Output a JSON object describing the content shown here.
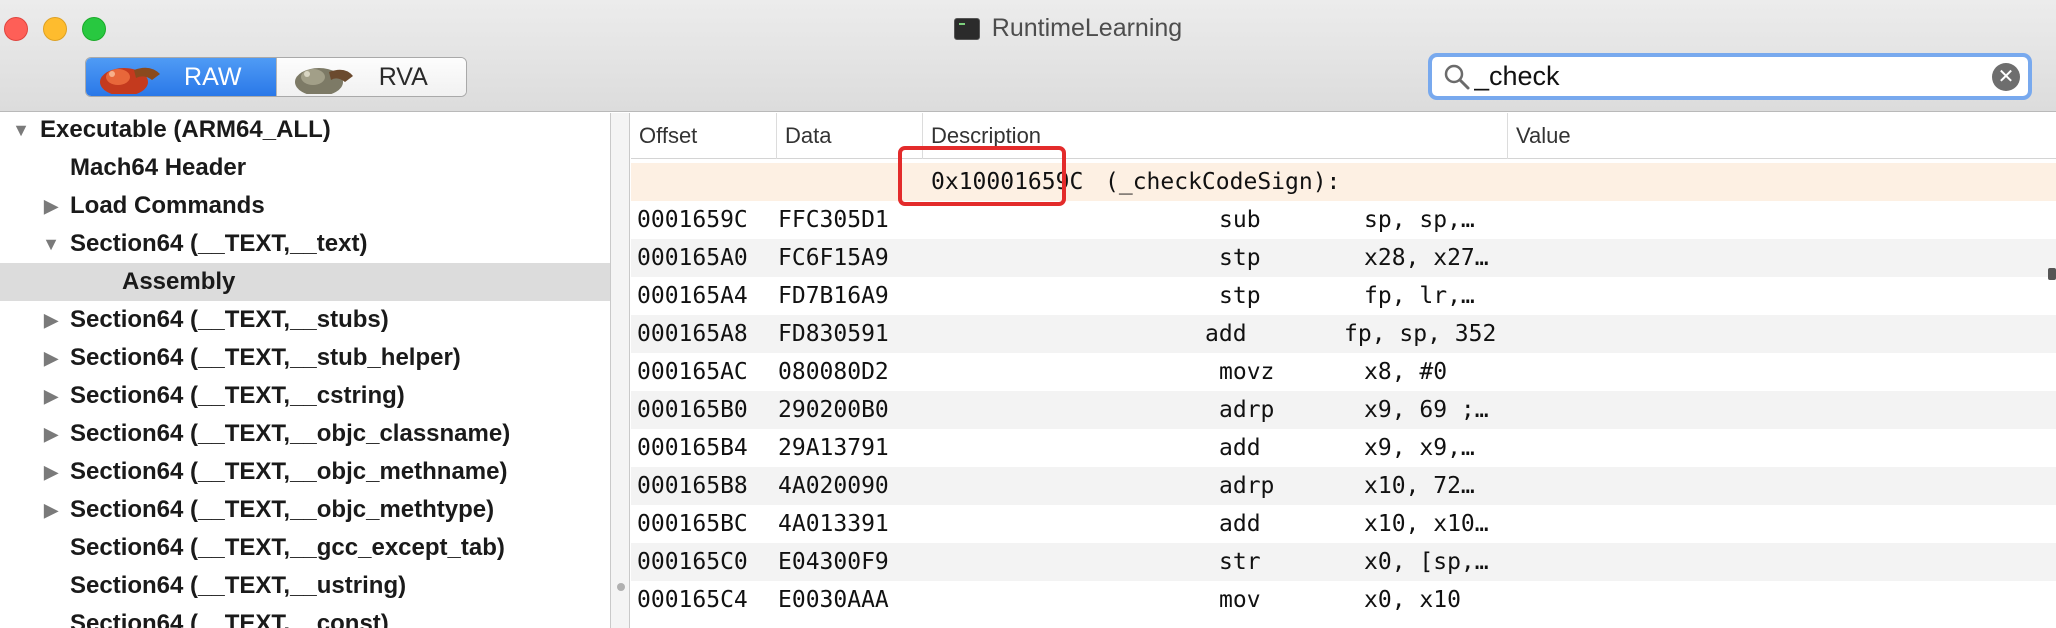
{
  "window": {
    "title": "RuntimeLearning"
  },
  "toolbar": {
    "segments": [
      {
        "label": "RAW",
        "selected": true
      },
      {
        "label": "RVA",
        "selected": false
      }
    ]
  },
  "search": {
    "value": "_check",
    "icon": "search-icon",
    "clear_icon": "clear-icon"
  },
  "sidebar": {
    "items": [
      {
        "label": "Executable  (ARM64_ALL)",
        "disclosure": "▼",
        "indent": 0
      },
      {
        "label": "Mach64 Header",
        "disclosure": "",
        "indent": 1
      },
      {
        "label": "Load Commands",
        "disclosure": "▶",
        "indent": 1
      },
      {
        "label": "Section64 (__TEXT,__text)",
        "disclosure": "▼",
        "indent": 1
      },
      {
        "label": "Assembly",
        "disclosure": "",
        "indent": 2,
        "selected": true
      },
      {
        "label": "Section64 (__TEXT,__stubs)",
        "disclosure": "▶",
        "indent": 1
      },
      {
        "label": "Section64 (__TEXT,__stub_helper)",
        "disclosure": "▶",
        "indent": 1
      },
      {
        "label": "Section64 (__TEXT,__cstring)",
        "disclosure": "▶",
        "indent": 1
      },
      {
        "label": "Section64 (__TEXT,__objc_classname)",
        "disclosure": "▶",
        "indent": 1
      },
      {
        "label": "Section64 (__TEXT,__objc_methname)",
        "disclosure": "▶",
        "indent": 1
      },
      {
        "label": "Section64 (__TEXT,__objc_methtype)",
        "disclosure": "▶",
        "indent": 1
      },
      {
        "label": "Section64 (__TEXT,__gcc_except_tab)",
        "disclosure": "",
        "indent": 1
      },
      {
        "label": "Section64 (__TEXT,__ustring)",
        "disclosure": "",
        "indent": 1
      },
      {
        "label": "Section64 (__TEXT,__const)",
        "disclosure": "",
        "indent": 1
      }
    ]
  },
  "table": {
    "columns": [
      "Offset",
      "Data",
      "Description",
      "Value"
    ],
    "label_row": {
      "address": "0x10001659C",
      "symbol": "(_checkCodeSign):"
    },
    "rows": [
      {
        "offset": "0001659C",
        "data": "FFC305D1",
        "mnemonic": "sub",
        "operands": "sp, sp,…"
      },
      {
        "offset": "000165A0",
        "data": "FC6F15A9",
        "mnemonic": "stp",
        "operands": "x28, x27…"
      },
      {
        "offset": "000165A4",
        "data": "FD7B16A9",
        "mnemonic": "stp",
        "operands": "fp, lr,…"
      },
      {
        "offset": "000165A8",
        "data": "FD830591",
        "mnemonic": "add",
        "operands": "fp, sp, 352"
      },
      {
        "offset": "000165AC",
        "data": "080080D2",
        "mnemonic": "movz",
        "operands": "x8, #0"
      },
      {
        "offset": "000165B0",
        "data": "290200B0",
        "mnemonic": "adrp",
        "operands": "x9, 69 ;…"
      },
      {
        "offset": "000165B4",
        "data": "29A13791",
        "mnemonic": "add",
        "operands": "x9, x9,…"
      },
      {
        "offset": "000165B8",
        "data": "4A020090",
        "mnemonic": "adrp",
        "operands": "x10, 72…"
      },
      {
        "offset": "000165BC",
        "data": "4A013391",
        "mnemonic": "add",
        "operands": "x10, x10…"
      },
      {
        "offset": "000165C0",
        "data": "E04300F9",
        "mnemonic": "str",
        "operands": "x0, [sp,…"
      },
      {
        "offset": "000165C4",
        "data": "E0030AAA",
        "mnemonic": "mov",
        "operands": "x0, x10"
      }
    ]
  },
  "colors": {
    "accent": "#2a78e8",
    "highlight_border": "#e32b2b",
    "label_row_bg": "#fdf0e3",
    "selected_row_bg": "#dcdcdc"
  }
}
